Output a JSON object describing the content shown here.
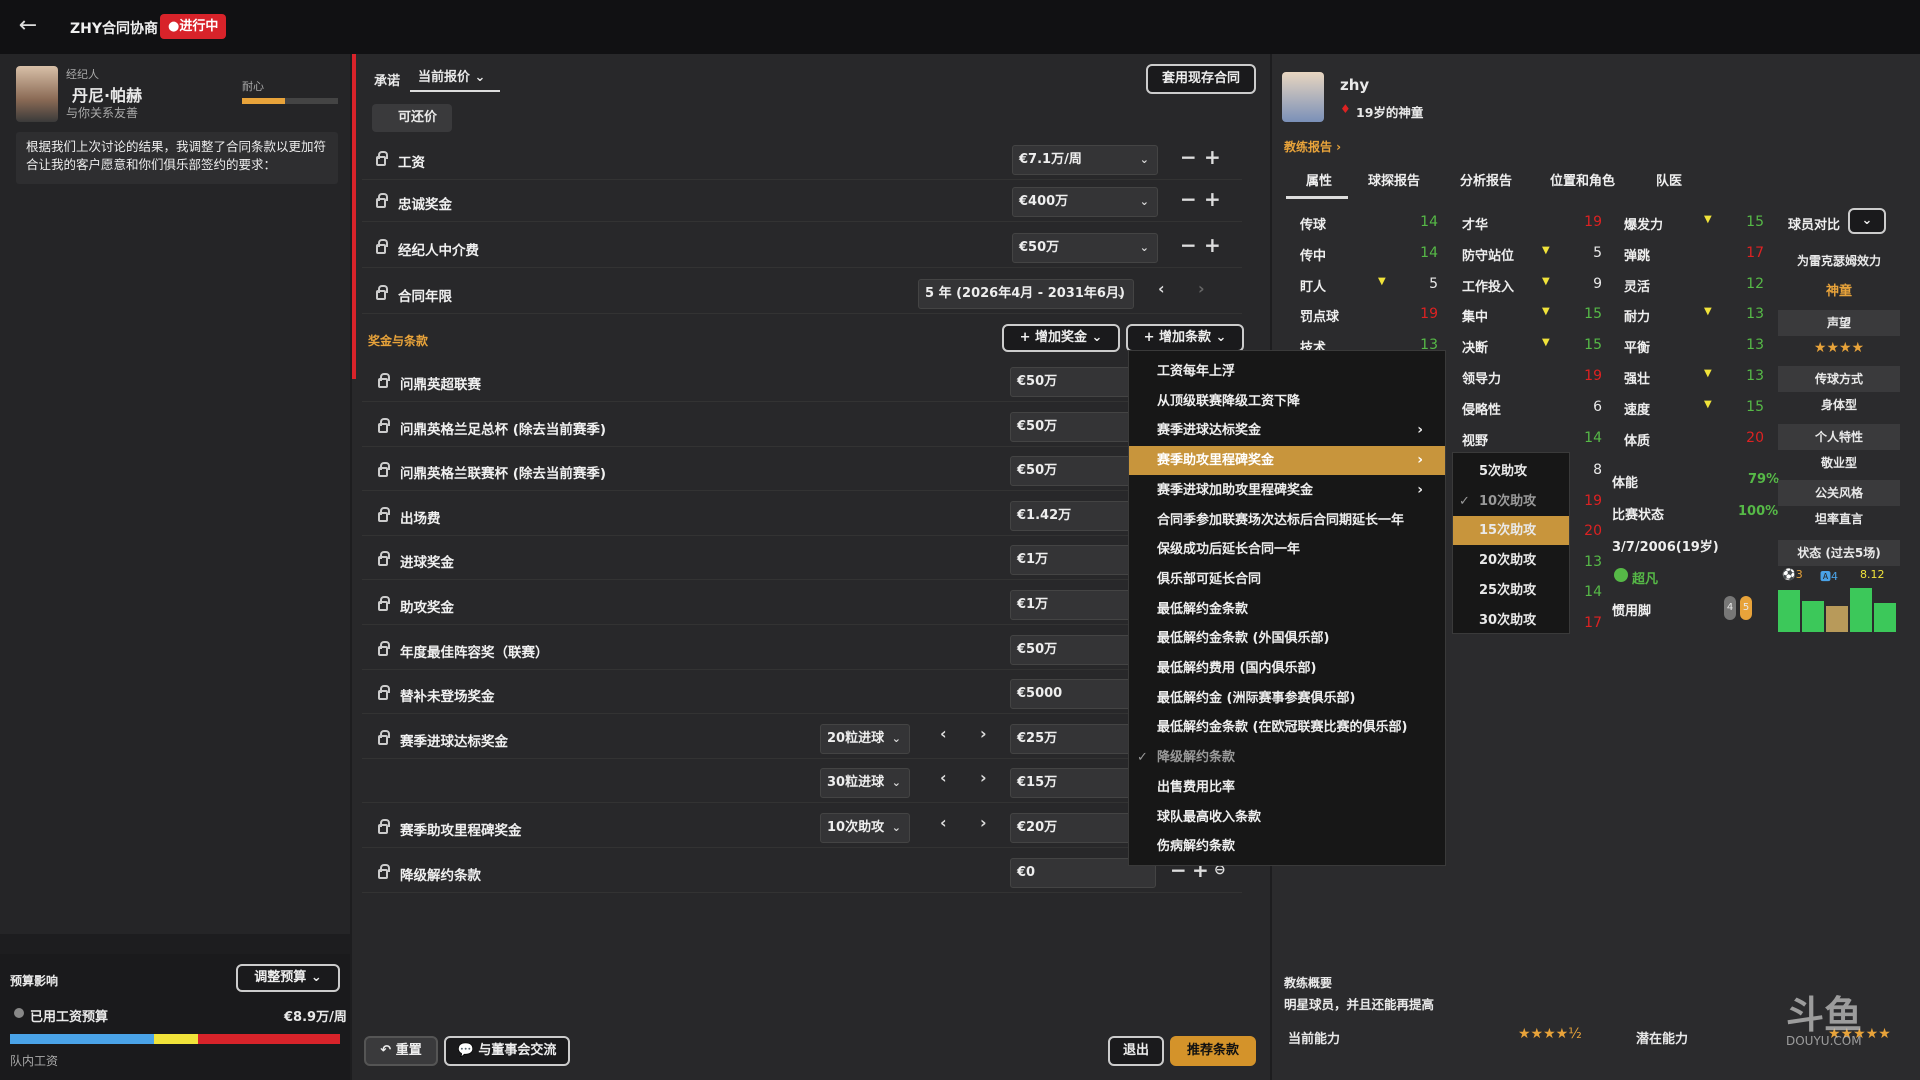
{
  "header": {
    "title": "ZHY合同协商",
    "status": "●进行中"
  },
  "agent": {
    "role": "经纪人",
    "name": "丹尼·帕赫",
    "relation": "与你关系友善",
    "mood_label": "耐心",
    "mood_level": 0.45,
    "message": "根据我们上次讨论的结果，我调整了合同条款以更加符合让我的客户愿意和你们俱乐部签约的要求："
  },
  "budget": {
    "title": "预算影响",
    "adjust": "调整预算",
    "used_label": "已用工资预算",
    "used_value": "€8.9万/周",
    "team_label": "队内工资",
    "colors": [
      "#4aa3e8",
      "#f1e33a",
      "#d8232a"
    ]
  },
  "toolbar": {
    "promise": "承诺",
    "offer": "当前报价",
    "apply": "套用现存合同",
    "negotiable": "可还价",
    "add_bonus": "增加奖金",
    "add_clause": "增加条款",
    "reset": "重置",
    "board": "与董事会交流",
    "exit": "退出",
    "recommend": "推荐条款",
    "bonus_section": "奖金与条款"
  },
  "contract": [
    {
      "label": "工资",
      "value": "€7.1万/周"
    },
    {
      "label": "忠诚奖金",
      "value": "€400万"
    },
    {
      "label": "经纪人中介费",
      "value": "€50万"
    },
    {
      "label": "合同年限",
      "value": "5 年 (2026年4月 - 2031年6月)"
    }
  ],
  "bonuses": [
    {
      "label": "问鼎英超联赛",
      "value": "€50万"
    },
    {
      "label": "问鼎英格兰足总杯 (除去当前赛季)",
      "value": "€50万"
    },
    {
      "label": "问鼎英格兰联赛杯 (除去当前赛季)",
      "value": "€50万"
    },
    {
      "label": "出场费",
      "value": "€1.42万"
    },
    {
      "label": "进球奖金",
      "value": "€1万"
    },
    {
      "label": "助攻奖金",
      "value": "€1万"
    },
    {
      "label": "年度最佳阵容奖（联赛）",
      "value": "€50万"
    },
    {
      "label": "替补未登场奖金",
      "value": "€5000"
    },
    {
      "label": "赛季进球达标奖金",
      "sel": "20粒进球",
      "value": "€25万"
    },
    {
      "label": "",
      "sel": "30粒进球",
      "value": "€15万"
    },
    {
      "label": "赛季助攻里程碑奖金",
      "sel": "10次助攻",
      "value": "€20万"
    },
    {
      "label": "降级解约条款",
      "value": "€0"
    }
  ],
  "menu": [
    "工资每年上浮",
    "从顶级联赛降级工资下降",
    "赛季进球达标奖金",
    "赛季助攻里程碑奖金",
    "赛季进球加助攻里程碑奖金",
    "合同季参加联赛场次达标后合同期延长一年",
    "保级成功后延长合同一年",
    "俱乐部可延长合同",
    "最低解约金条款",
    "最低解约金条款 (外国俱乐部)",
    "最低解约费用 (国内俱乐部)",
    "最低解约金 (洲际赛事参赛俱乐部)",
    "最低解约金条款 (在欧冠联赛比赛的俱乐部)",
    "降级解约条款",
    "出售费用比率",
    "球队最高收入条款",
    "伤病解约条款"
  ],
  "submenu": [
    "5次助攻",
    "10次助攻",
    "15次助攻",
    "20次助攻",
    "25次助攻",
    "30次助攻"
  ],
  "player": {
    "name": "zhy",
    "desc": "19岁的神童",
    "coach_report": "教练报告 ›",
    "tabs": [
      "属性",
      "球探报告",
      "分析报告",
      "位置和角色",
      "队医"
    ],
    "col1": [
      [
        "传球",
        "14"
      ],
      [
        "传中",
        "14"
      ],
      [
        "盯人",
        "5"
      ],
      [
        "罚点球",
        "19"
      ],
      [
        "技术",
        "13"
      ]
    ],
    "col2": [
      [
        "才华",
        "19"
      ],
      [
        "防守站位",
        "5"
      ],
      [
        "工作投入",
        "9"
      ],
      [
        "集中",
        "15"
      ],
      [
        "决断",
        "15"
      ],
      [
        "领导力",
        "19"
      ],
      [
        "侵略性",
        "6"
      ],
      [
        "视野",
        "14"
      ]
    ],
    "col2b": [
      "8",
      "19",
      "20",
      "13",
      "14",
      "17"
    ],
    "col3": [
      [
        "爆发力",
        "15"
      ],
      [
        "弹跳",
        "17"
      ],
      [
        "灵活",
        "12"
      ],
      [
        "耐力",
        "13"
      ],
      [
        "平衡",
        "13"
      ],
      [
        "强壮",
        "13"
      ],
      [
        "速度",
        "15"
      ],
      [
        "体质",
        "20"
      ]
    ],
    "stamina_label": "体能",
    "stamina": "79%",
    "form_label": "比赛状态",
    "form": "100%",
    "dob": "3/7/2006(19岁)",
    "ability": "超凡",
    "foot_label": "惯用脚",
    "foot_l": "4",
    "foot_r": "5",
    "compare": "球员对比",
    "effort": "为雷克瑟姆效力",
    "effort_v": "神童",
    "rep": "声望",
    "rep_stars": "★★★★",
    "style": "传球方式",
    "style_v": "身体型",
    "trait": "个人特性",
    "trait_v": "敬业型",
    "media": "公关风格",
    "media_v": "坦率直言",
    "recent": "状态 (过去5场)",
    "r_goals": "⚽3",
    "r_assists": "🅰4",
    "r_rating": "8.12",
    "bars": [
      0.8,
      0.6,
      0.5,
      0.85,
      0.55
    ],
    "summary_title": "教练概要",
    "summary": "明星球员，并且还能再提高",
    "cur": "当前能力",
    "cur_stars": "★★★★½",
    "pot": "潜在能力",
    "pot_stars": "★★★★★"
  },
  "watermark": "斗鱼",
  "watermark2": "DOUYU.COM"
}
